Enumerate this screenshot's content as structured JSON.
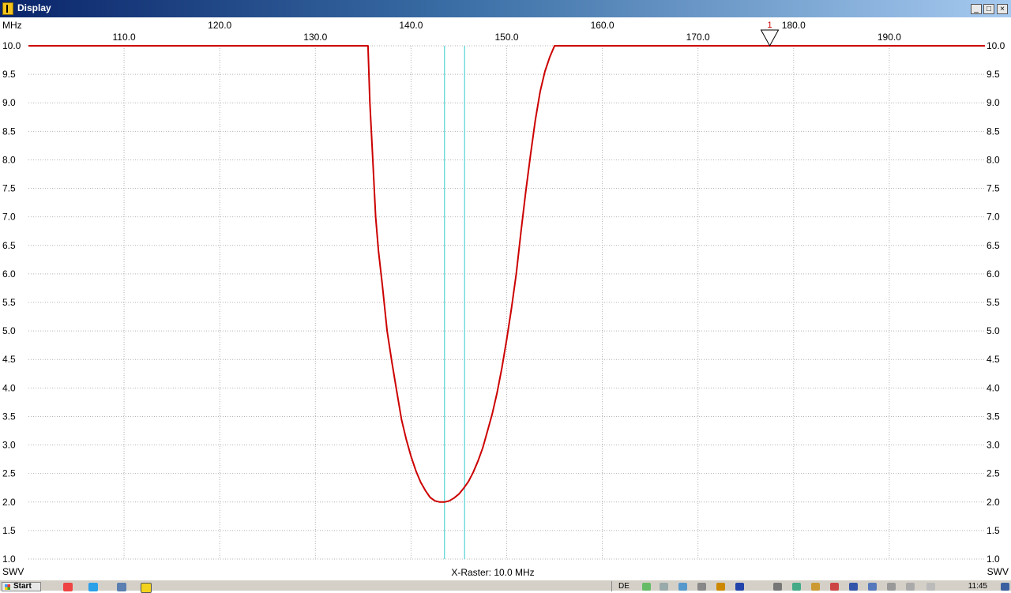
{
  "window": {
    "title": "Display",
    "buttons": [
      "_",
      "□",
      "×"
    ]
  },
  "chart_data": {
    "type": "line",
    "x_unit_label": "MHz",
    "y_unit_label": "SWV",
    "x_raster_label": "X-Raster: 10.0 MHz",
    "xlim": [
      100.0,
      200.0
    ],
    "ylim": [
      1.0,
      10.0
    ],
    "x_ticks_top_row": [
      "120.0",
      "140.0",
      "160.0",
      "180.0"
    ],
    "x_ticks_top_row_values": [
      120,
      140,
      160,
      180
    ],
    "x_ticks_bottom_row": [
      "110.0",
      "130.0",
      "150.0",
      "170.0",
      "190.0"
    ],
    "x_ticks_bottom_row_values": [
      110,
      130,
      150,
      170,
      190
    ],
    "y_ticks": [
      "10.0",
      "9.5",
      "9.0",
      "8.5",
      "8.0",
      "7.5",
      "7.0",
      "6.5",
      "6.0",
      "5.5",
      "5.0",
      "4.5",
      "4.0",
      "3.5",
      "3.0",
      "2.5",
      "2.0",
      "1.5",
      "1.0"
    ],
    "grid": true,
    "series": [
      {
        "color": "#cc0000",
        "x": [
          100.0,
          135.5,
          135.7,
          136.0,
          136.3,
          136.6,
          137.0,
          137.5,
          138.0,
          138.5,
          139.0,
          139.5,
          140.0,
          140.5,
          141.0,
          141.5,
          142.0,
          142.5,
          143.0,
          143.5,
          144.0,
          144.5,
          145.0,
          145.5,
          146.0,
          146.5,
          147.0,
          147.5,
          148.0,
          148.5,
          149.0,
          149.5,
          150.0,
          150.5,
          151.0,
          151.5,
          152.0,
          152.5,
          153.0,
          153.5,
          154.0,
          154.5,
          155.0,
          155.3,
          200.0
        ],
        "y": [
          10.0,
          10.0,
          9.0,
          8.0,
          7.0,
          6.4,
          5.8,
          5.0,
          4.45,
          3.95,
          3.45,
          3.1,
          2.8,
          2.55,
          2.35,
          2.2,
          2.08,
          2.02,
          2.0,
          2.0,
          2.02,
          2.07,
          2.14,
          2.24,
          2.36,
          2.52,
          2.72,
          2.95,
          3.25,
          3.55,
          3.92,
          4.35,
          4.85,
          5.4,
          6.0,
          6.75,
          7.45,
          8.1,
          8.7,
          9.2,
          9.55,
          9.8,
          10.0,
          10.0,
          10.0
        ]
      }
    ],
    "vertical_markers": {
      "color": "#33cccc",
      "x": [
        143.5,
        145.6
      ]
    },
    "marker": {
      "label": "1",
      "x": 177.5,
      "y": 10.0
    }
  },
  "taskbar": {
    "start_label": "Start",
    "language": "DE",
    "clock": "11:45"
  }
}
